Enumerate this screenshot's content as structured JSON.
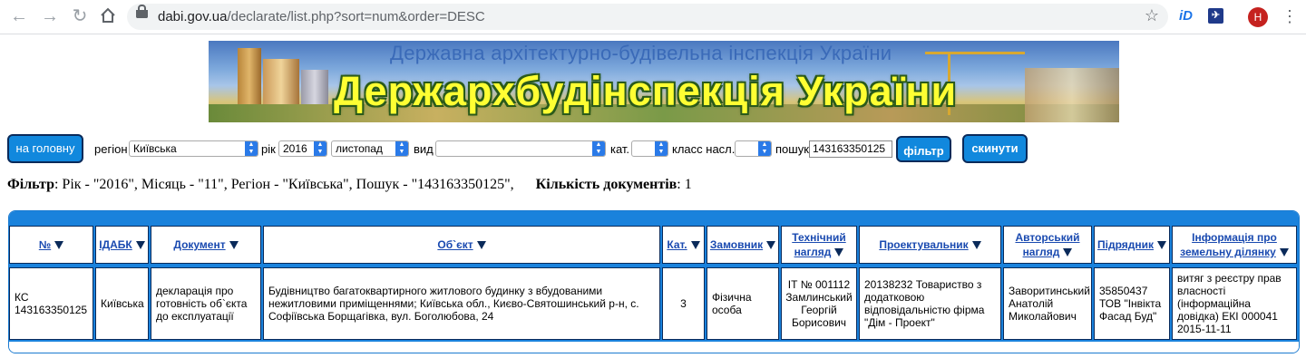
{
  "browser": {
    "url_host": "dabi.gov.ua",
    "url_path": "/declarate/list.php?sort=num&order=DESC",
    "ext_id_label": "iD",
    "avatar_letter": "Н"
  },
  "banner": {
    "subtitle": "Державна архітектурно-будівельна інспекція України",
    "title": "Держархбудінспекція України"
  },
  "filters": {
    "home_button": "на головну",
    "region_label": "регіон",
    "region_value": "Київська",
    "year_label": "рік",
    "year_value": "2016",
    "month_value": "листопад",
    "type_label": "вид",
    "type_value": "",
    "cat_label": "кат.",
    "cat_value": "",
    "class_label": "класс насл.",
    "class_value": "",
    "search_label": "пошук",
    "search_value": "143163350125",
    "filter_button": "фільтр",
    "reset_button": "скинути"
  },
  "summary": {
    "filter_label": "Фільтр",
    "filter_text": ": Рік - \"2016\", Місяць - \"11\", Регіон - \"Київська\", Пошук - \"143163350125\",",
    "count_label": "Кількість документів",
    "count_text": ": 1"
  },
  "table": {
    "headers": {
      "num": "№",
      "idabk": "ІДАБК",
      "document": "Документ",
      "object": "Об`єкт",
      "cat": "Кат.",
      "customer": "Замовник",
      "tech_l1": "Технічний",
      "tech_l2": "нагляд",
      "designer": "Проектувальник",
      "author_l1": "Авторський",
      "author_l2": "нагляд",
      "contractor": "Підрядник",
      "land_l1": "Інформація про",
      "land_l2": "земельну ділянку"
    },
    "row": {
      "num_l1": "КС",
      "num_l2": "143163350125",
      "idabk": "Київська",
      "document": "декларація про готовність об`єкта до експлуатації",
      "object": "Будівництво багатоквартирного житлового будинку з вбудованими нежитловими приміщеннями; Київська обл., Києво-Святошинський р-н, с. Софіївська Борщагівка, вул. Боголюбова, 24",
      "cat": "3",
      "customer": "Фізична особа",
      "tech": "ІТ № 001112 Замлинський Георгій Борисович",
      "designer": "20138232 Товариство з додатковою відповідальністю фірма \"Дім - Проект\"",
      "author": "Заворитинський Анатолій Миколайович",
      "contractor": "35850437 ТОВ \"Інвікта Фасад Буд\"",
      "land": "витяг з реєстру прав власності (інформаційна довідка) ЕКІ 000041 2015-11-11"
    }
  }
}
